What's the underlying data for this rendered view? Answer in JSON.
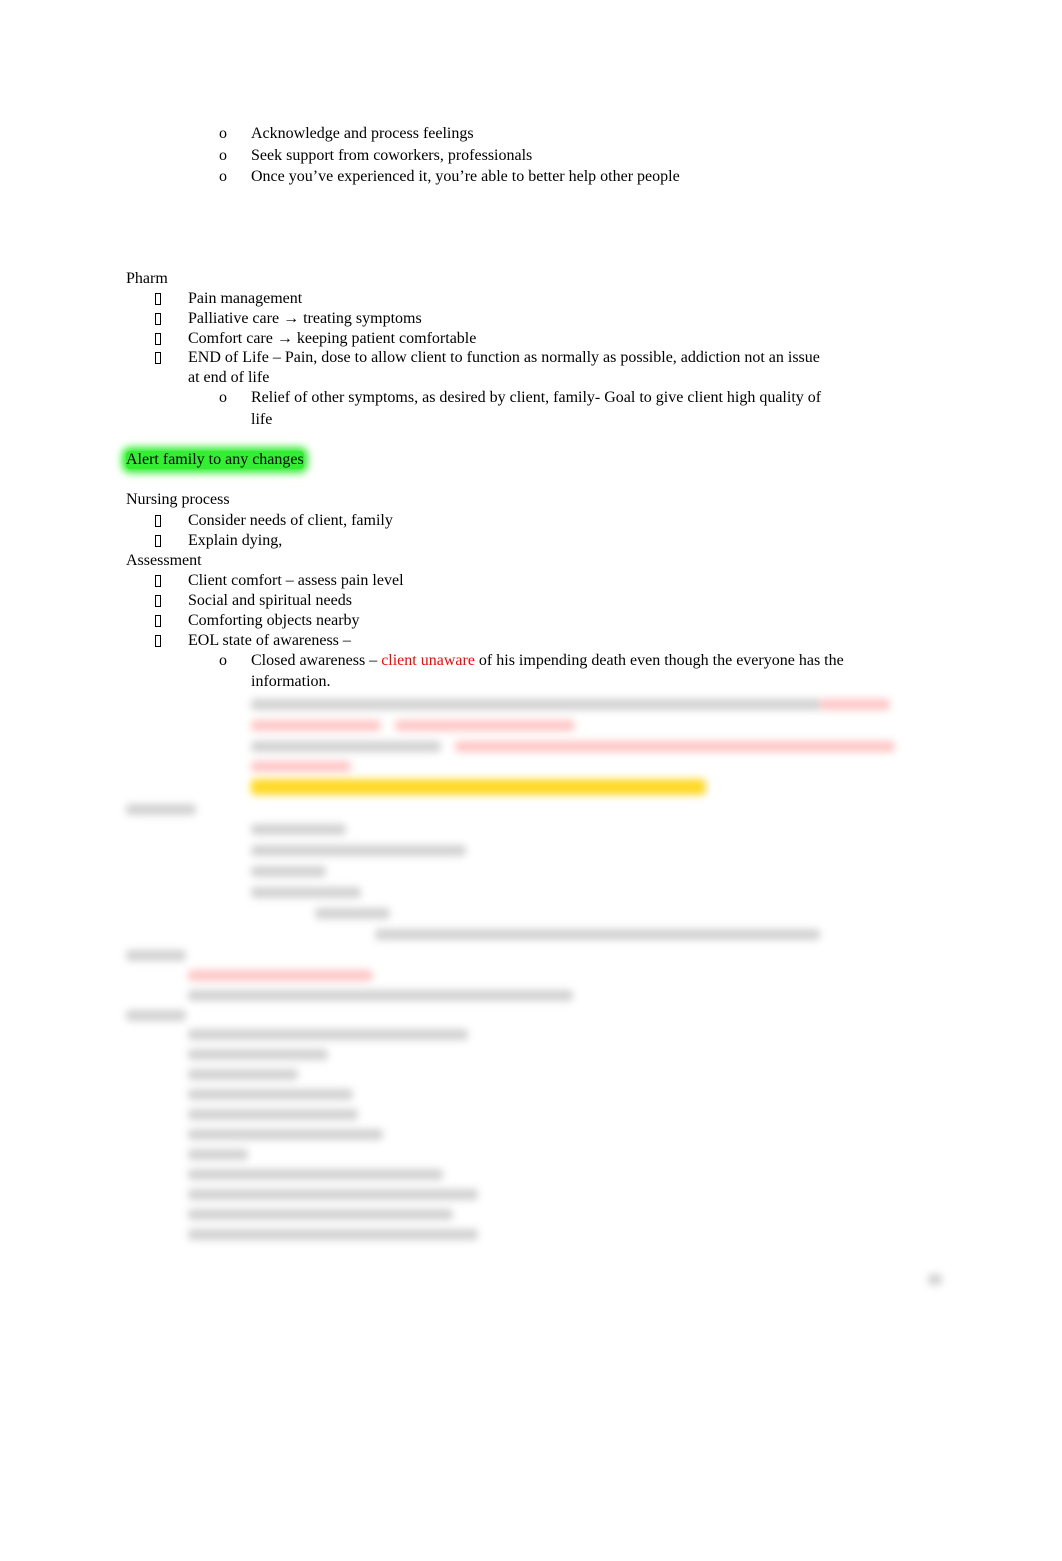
{
  "section_top": {
    "items": [
      "Acknowledge and process feelings",
      "Seek support from coworkers, professionals",
      "Once you’ve experienced it, you’re able to better help other people"
    ]
  },
  "pharm": {
    "heading": "Pharm",
    "items": [
      "Pain management",
      "Palliative care → treating symptoms",
      "Comfort care → keeping patient comfortable",
      "END of Life – Pain, dose to allow client to function as normally as possible, addiction not an issue",
      "at end of life"
    ],
    "sub_item_line1": "Relief of other symptoms, as desired by client, family- Goal to give client high quality of",
    "sub_item_line2": "life"
  },
  "highlight": {
    "text": "Alert family to any changes",
    "color": "#33ee33"
  },
  "nursing": {
    "heading": "Nursing process",
    "items": [
      "Consider needs of client, family",
      "Explain dying,"
    ]
  },
  "assessment": {
    "heading": "Assessment",
    "items": [
      "Client comfort – assess pain level",
      "Social and spiritual needs",
      "Comforting objects nearby",
      "EOL state of awareness –"
    ],
    "closed_awareness": {
      "prefix": "Closed awareness – ",
      "highlighted": "client unaware",
      "suffix": " of his impending death even though the everyone has the",
      "line2": "information.",
      "highlight_color": "#ff0000"
    }
  },
  "sub_bullet": "o",
  "blurred_region": "obscured preview content"
}
